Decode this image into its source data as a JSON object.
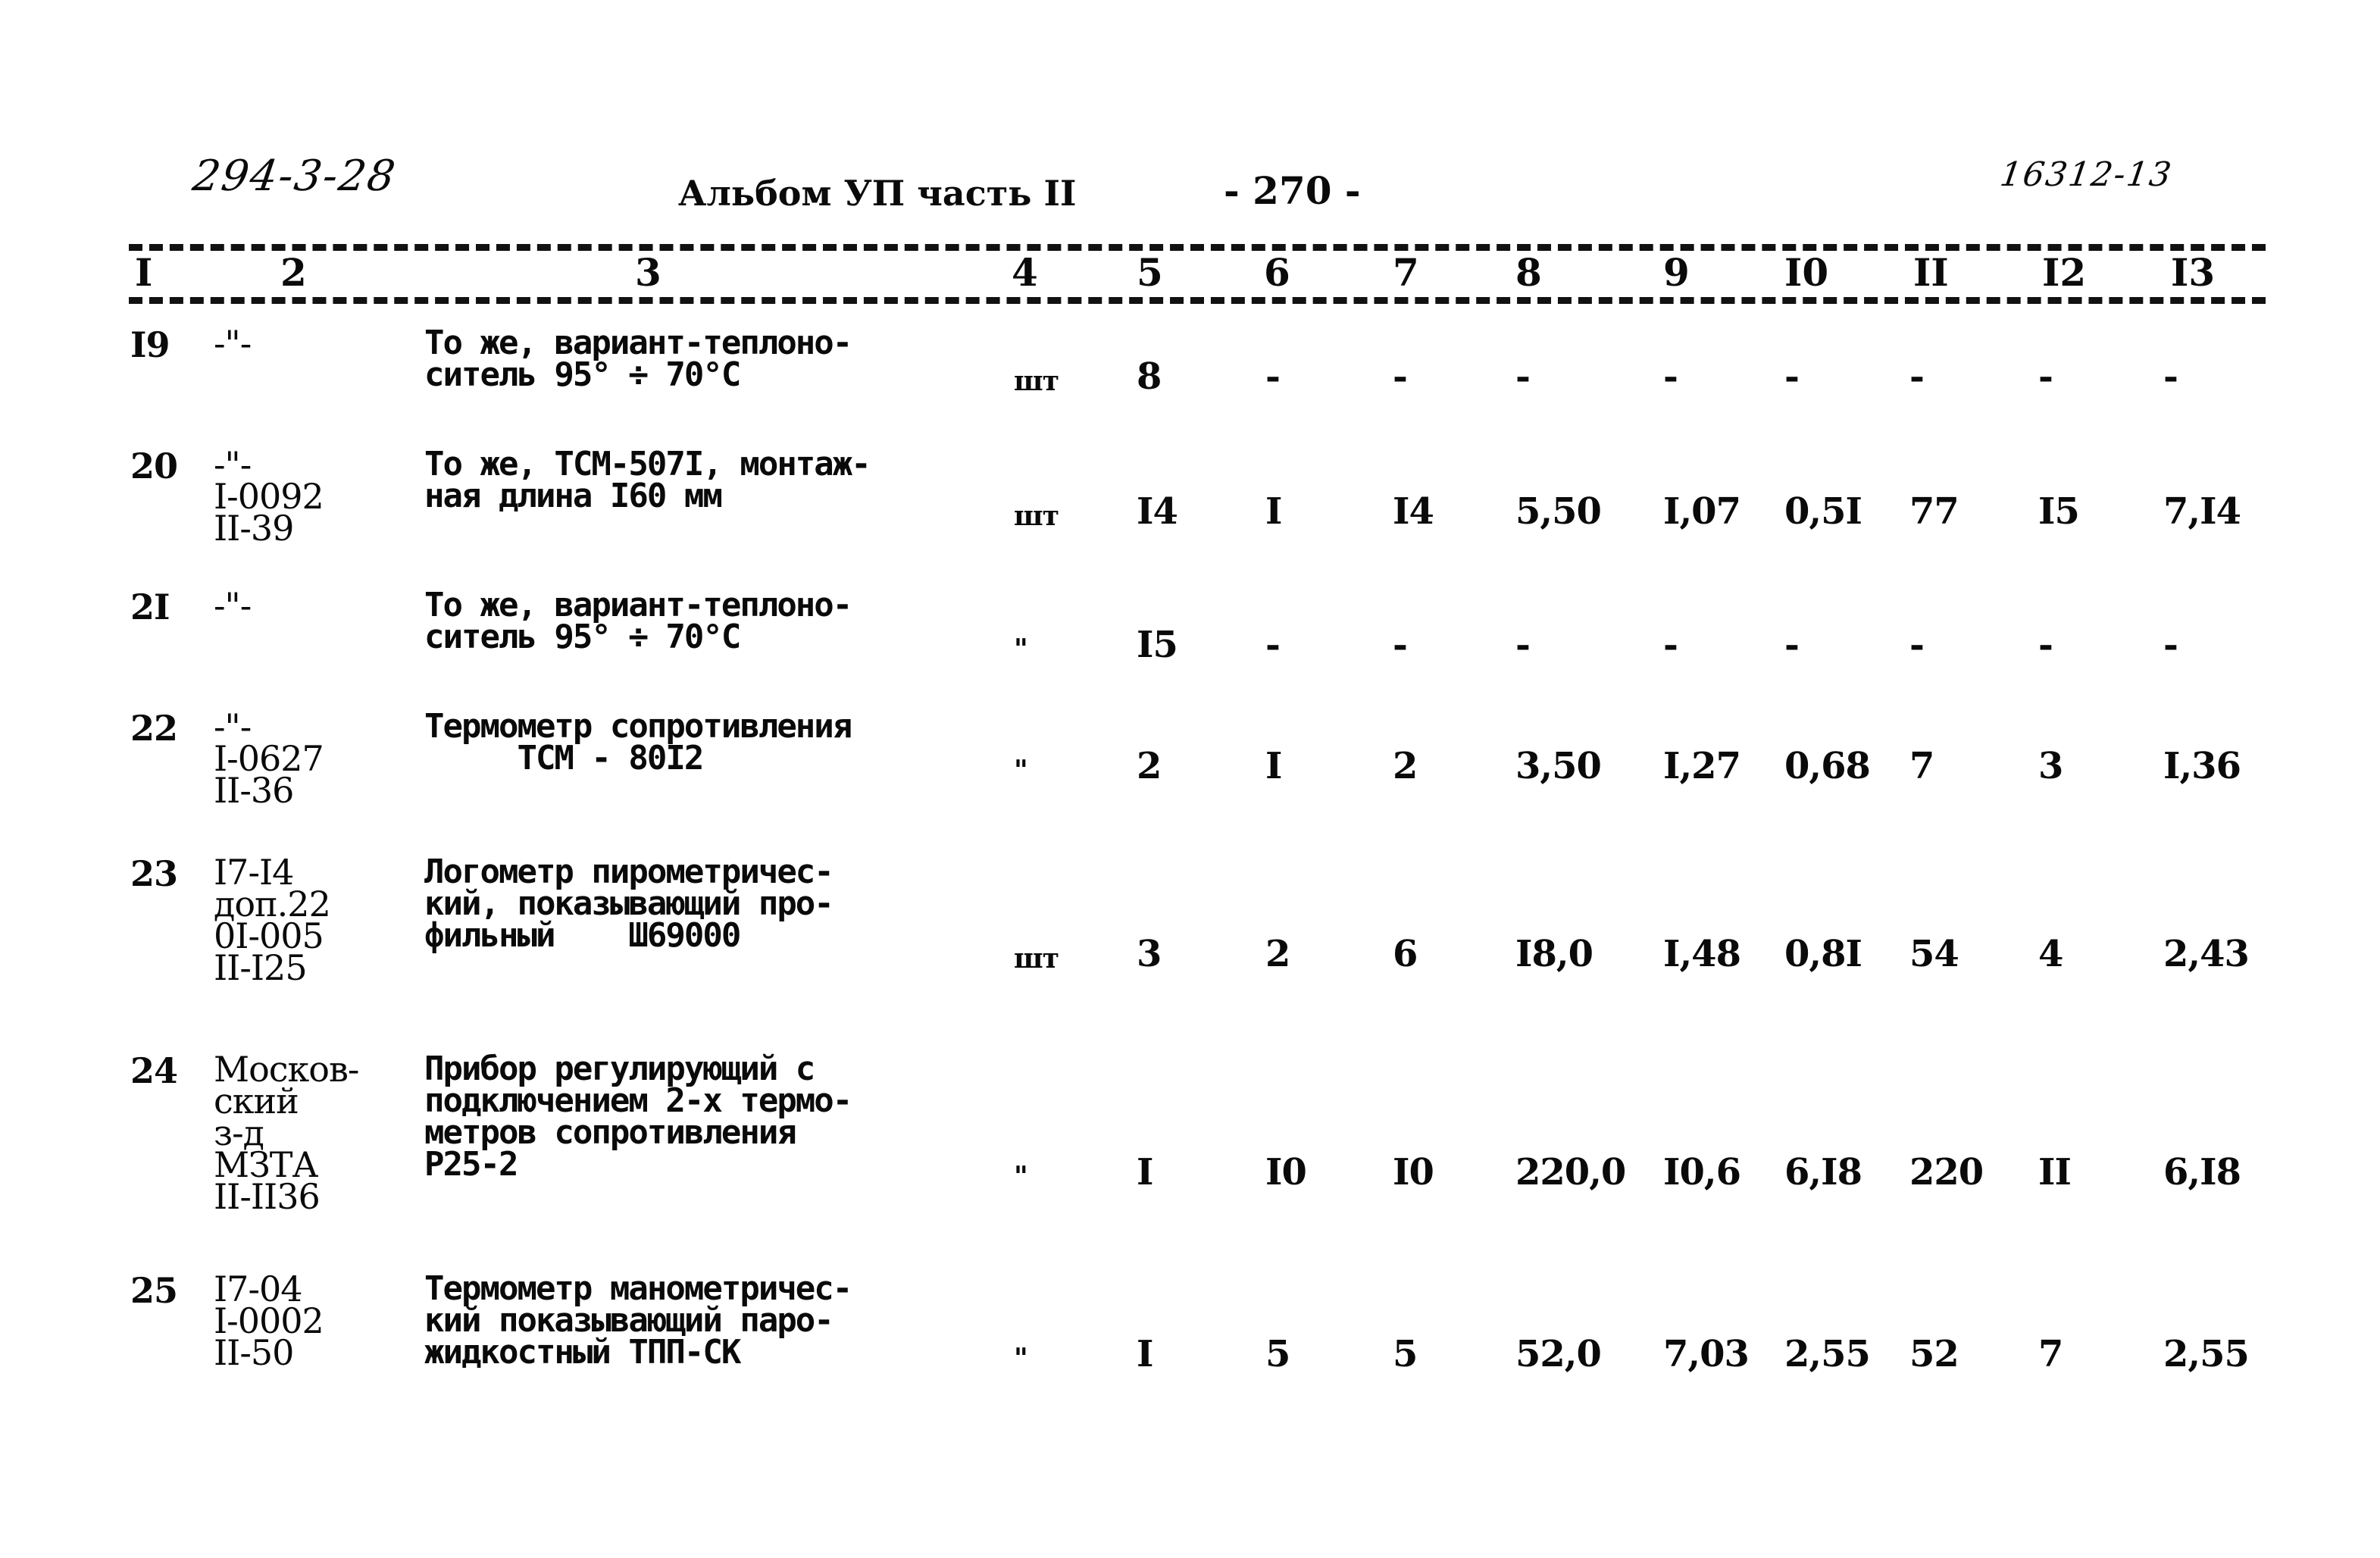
{
  "header": {
    "code_left": "294-3-28",
    "album_title": "Альбом УП  часть II",
    "page_number": "- 270 -",
    "code_right": "16312-13"
  },
  "columns": [
    "I",
    "2",
    "3",
    "4",
    "5",
    "6",
    "7",
    "8",
    "9",
    "I0",
    "II",
    "I2",
    "I3"
  ],
  "rows": [
    {
      "no": "I9",
      "ref": [
        "-\"-"
      ],
      "desc": [
        "То же, вариант-теплоно-",
        "ситель 95° ÷ 70°С"
      ],
      "unit": "шт",
      "c5": "8",
      "c6": "-",
      "c7": "-",
      "c8": "-",
      "c9": "-",
      "c10": "-",
      "c11": "-",
      "c12": "-",
      "c13": "-"
    },
    {
      "no": "20",
      "ref": [
        "-\"-",
        "I-0092",
        "II-39"
      ],
      "desc": [
        "То же, ТСМ-507I, монтаж-",
        "ная длина I60 мм"
      ],
      "unit": "шт",
      "c5": "I4",
      "c6": "I",
      "c7": "I4",
      "c8": "5,50",
      "c9": "I,07",
      "c10": "0,5I",
      "c11": "77",
      "c12": "I5",
      "c13": "7,I4"
    },
    {
      "no": "2I",
      "ref": [
        "-\"-"
      ],
      "desc": [
        "То же, вариант-теплоно-",
        "ситель 95° ÷ 70°С"
      ],
      "unit": "\"",
      "c5": "I5",
      "c6": "-",
      "c7": "-",
      "c8": "-",
      "c9": "-",
      "c10": "-",
      "c11": "-",
      "c12": "-",
      "c13": "-"
    },
    {
      "no": "22",
      "ref": [
        "-\"-",
        "I-0627",
        "II-36"
      ],
      "desc": [
        "Термометр сопротивления",
        "     ТСМ - 80I2"
      ],
      "unit": "\"",
      "c5": "2",
      "c6": "I",
      "c7": "2",
      "c8": "3,50",
      "c9": "I,27",
      "c10": "0,68",
      "c11": "7",
      "c12": "3",
      "c13": "I,36"
    },
    {
      "no": "23",
      "ref": [
        "I7-I4",
        "доп.22",
        "0I-005",
        "II-I25"
      ],
      "desc": [
        "Логометр пирометричес-",
        "кий, показывающий про-",
        "фильный    Ш69000"
      ],
      "unit": "шт",
      "c5": "3",
      "c6": "2",
      "c7": "6",
      "c8": "I8,0",
      "c9": "I,48",
      "c10": "0,8I",
      "c11": "54",
      "c12": "4",
      "c13": "2,43"
    },
    {
      "no": "24",
      "ref": [
        "Москов-",
        "ский",
        "з-д",
        "МЗТА",
        "II-II36"
      ],
      "desc": [
        "Прибор регулирующий с",
        "подключением 2-х термо-",
        "метров сопротивления",
        "Р25-2"
      ],
      "unit": "\"",
      "c5": "I",
      "c6": "I0",
      "c7": "I0",
      "c8": "220,0",
      "c9": "I0,6",
      "c10": "6,I8",
      "c11": "220",
      "c12": "II",
      "c13": "6,I8"
    },
    {
      "no": "25",
      "ref": [
        "I7-04",
        "I-0002",
        "II-50"
      ],
      "desc": [
        "Термометр манометричес-",
        "кий показывающий паро-",
        "жидкостный ТПП-СК"
      ],
      "unit": "\"",
      "c5": "I",
      "c6": "5",
      "c7": "5",
      "c8": "52,0",
      "c9": "7,03",
      "c10": "2,55",
      "c11": "52",
      "c12": "7",
      "c13": "2,55"
    }
  ]
}
